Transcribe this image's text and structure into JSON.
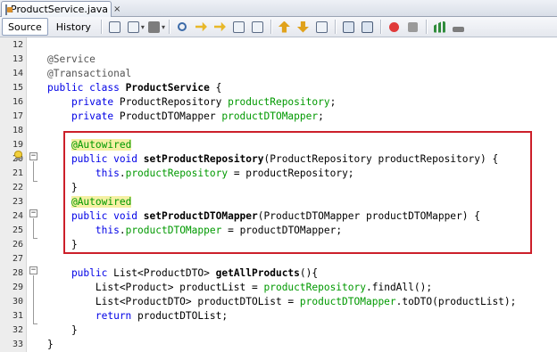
{
  "file_tab": {
    "label": "ProductService.java",
    "close_glyph": "×"
  },
  "toolbar": {
    "source_label": "Source",
    "history_label": "History",
    "icons": [
      "last-edit-icon",
      "back-icon",
      "forward-icon",
      "find-selection-icon",
      "find-previous-icon",
      "find-next-icon",
      "toggle-highlight-icon",
      "toggle-rect-select-icon",
      "previous-bookmark-icon",
      "next-bookmark-icon",
      "toggle-bookmark-icon",
      "shift-left-icon",
      "shift-right-icon",
      "start-macro-icon",
      "stop-macro-icon",
      "comment-icon",
      "uncomment-icon"
    ]
  },
  "colors": {
    "keyword": "#0000e6",
    "field": "#009900",
    "annotation_highlight": "#f5f0a3",
    "selection_box": "#cc1f2a"
  },
  "lines": [
    {
      "num": "12",
      "parts": []
    },
    {
      "num": "13",
      "parts": [
        {
          "t": "@Service",
          "c": "ann"
        }
      ]
    },
    {
      "num": "14",
      "parts": [
        {
          "t": "@Transactional",
          "c": "ann"
        }
      ]
    },
    {
      "num": "15",
      "parts": [
        {
          "t": "public class ",
          "c": "kw"
        },
        {
          "t": "ProductService",
          "c": "b"
        },
        {
          "t": " {",
          "c": ""
        }
      ]
    },
    {
      "num": "16",
      "parts": [
        {
          "t": "    private ",
          "c": "kw"
        },
        {
          "t": "ProductRepository ",
          "c": ""
        },
        {
          "t": "productRepository",
          "c": "fld"
        },
        {
          "t": ";",
          "c": ""
        }
      ]
    },
    {
      "num": "17",
      "parts": [
        {
          "t": "    private ",
          "c": "kw"
        },
        {
          "t": "ProductDTOMapper ",
          "c": ""
        },
        {
          "t": "productDTOMapper",
          "c": "fld"
        },
        {
          "t": ";",
          "c": ""
        }
      ]
    },
    {
      "num": "18",
      "parts": []
    },
    {
      "num": "19",
      "parts": [
        {
          "t": "    ",
          "c": ""
        },
        {
          "t": "@Autowired",
          "c": "ann-hl"
        }
      ]
    },
    {
      "num": "20",
      "parts": [
        {
          "t": "    public void ",
          "c": "kw"
        },
        {
          "t": "setProductRepository",
          "c": "b"
        },
        {
          "t": "(ProductRepository productRepository) {",
          "c": ""
        }
      ]
    },
    {
      "num": "21",
      "parts": [
        {
          "t": "        this",
          "c": "kw"
        },
        {
          "t": ".",
          "c": ""
        },
        {
          "t": "productRepository",
          "c": "fld"
        },
        {
          "t": " = productRepository;",
          "c": ""
        }
      ]
    },
    {
      "num": "22",
      "parts": [
        {
          "t": "    }",
          "c": ""
        }
      ]
    },
    {
      "num": "23",
      "parts": [
        {
          "t": "    ",
          "c": ""
        },
        {
          "t": "@Autowired",
          "c": "ann-hl"
        }
      ]
    },
    {
      "num": "24",
      "parts": [
        {
          "t": "    public void ",
          "c": "kw"
        },
        {
          "t": "setProductDTOMapper",
          "c": "b"
        },
        {
          "t": "(ProductDTOMapper productDTOMapper) {",
          "c": ""
        }
      ]
    },
    {
      "num": "25",
      "parts": [
        {
          "t": "        this",
          "c": "kw"
        },
        {
          "t": ".",
          "c": ""
        },
        {
          "t": "productDTOMapper",
          "c": "fld"
        },
        {
          "t": " = productDTOMapper;",
          "c": ""
        }
      ]
    },
    {
      "num": "26",
      "parts": [
        {
          "t": "    }",
          "c": ""
        }
      ]
    },
    {
      "num": "27",
      "parts": []
    },
    {
      "num": "28",
      "parts": [
        {
          "t": "    public ",
          "c": "kw"
        },
        {
          "t": "List<ProductDTO> ",
          "c": ""
        },
        {
          "t": "getAllProducts",
          "c": "b"
        },
        {
          "t": "(){",
          "c": ""
        }
      ]
    },
    {
      "num": "29",
      "parts": [
        {
          "t": "        List<Product> productList = ",
          "c": ""
        },
        {
          "t": "productRepository",
          "c": "fld"
        },
        {
          "t": ".findAll();",
          "c": ""
        }
      ]
    },
    {
      "num": "30",
      "parts": [
        {
          "t": "        List<ProductDTO> productDTOList = ",
          "c": ""
        },
        {
          "t": "productDTOMapper",
          "c": "fld"
        },
        {
          "t": ".toDTO(productList);",
          "c": ""
        }
      ]
    },
    {
      "num": "31",
      "parts": [
        {
          "t": "        return ",
          "c": "kw"
        },
        {
          "t": "productDTOList;",
          "c": ""
        }
      ]
    },
    {
      "num": "32",
      "parts": [
        {
          "t": "    }",
          "c": ""
        }
      ]
    },
    {
      "num": "33",
      "parts": [
        {
          "t": "}",
          "c": ""
        }
      ]
    }
  ]
}
